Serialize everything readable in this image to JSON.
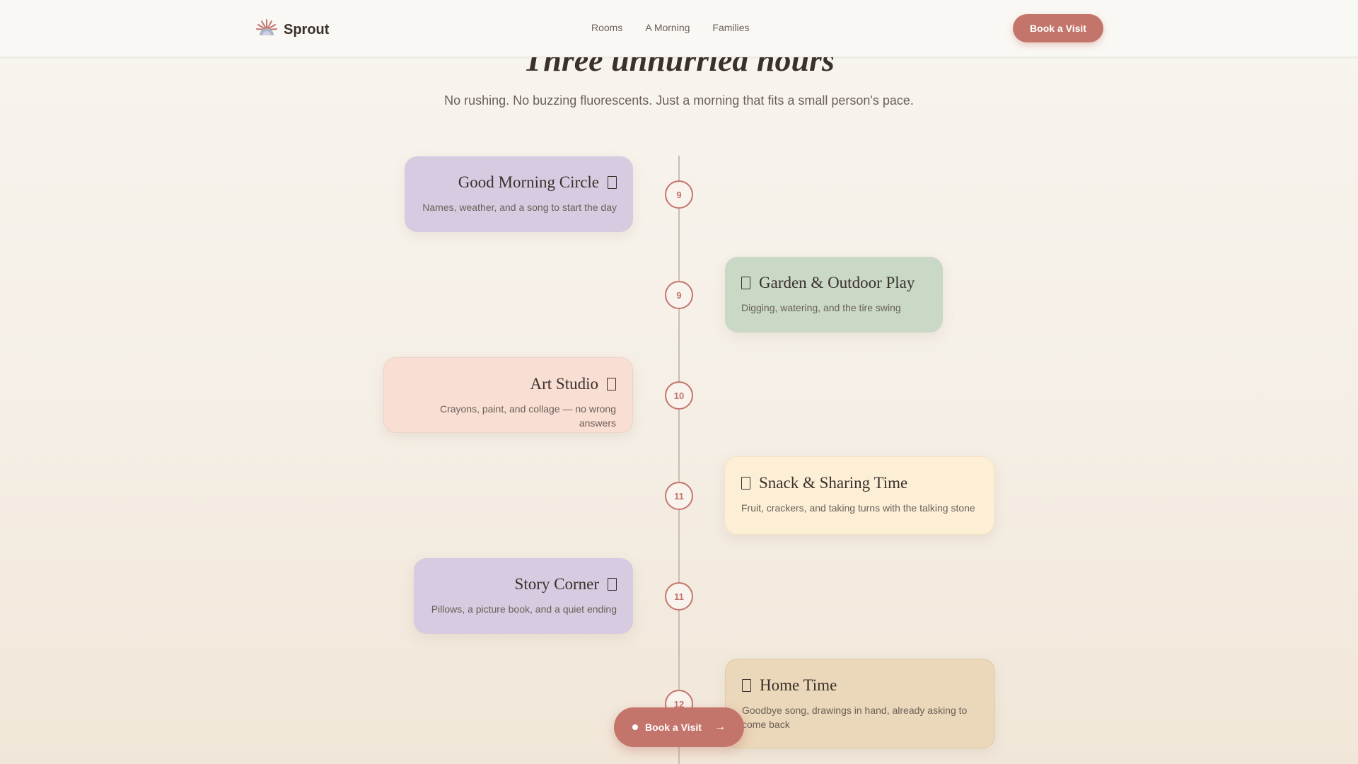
{
  "header": {
    "brand": "Sprout",
    "nav": [
      "Rooms",
      "A Morning",
      "Families"
    ],
    "cta": "Book a Visit"
  },
  "section": {
    "title": "Three unhurried hours",
    "subtitle": "No rushing. No buzzing fluorescents. Just a morning that fits a small person's pace."
  },
  "timeline": [
    {
      "hour": "9",
      "title": "Good Morning Circle",
      "desc": "Names, weather, and a song to start the day",
      "side": "left"
    },
    {
      "hour": "9",
      "title": "Garden & Outdoor Play",
      "desc": "Digging, watering, and the tire swing",
      "side": "right"
    },
    {
      "hour": "10",
      "title": "Art Studio",
      "desc": "Crayons, paint, and collage — no wrong answers",
      "side": "left"
    },
    {
      "hour": "11",
      "title": "Snack & Sharing Time",
      "desc": "Fruit, crackers, and taking turns with the talking stone",
      "side": "right"
    },
    {
      "hour": "11",
      "title": "Story Corner",
      "desc": "Pillows, a picture book, and a quiet ending",
      "side": "left"
    },
    {
      "hour": "12",
      "title": "Home Time",
      "desc": "Goodbye song, drawings in hand, already asking to come back",
      "side": "right"
    }
  ],
  "floating_cta": {
    "label": "Book a Visit",
    "arrow": "→"
  },
  "colors": {
    "accent": "#c4756b",
    "lavender": "#d6cbe0",
    "sage": "#c9d9c6",
    "peach": "#f9ded4",
    "cream": "#fdefd6",
    "sand": "#ebd7b9"
  },
  "icons": {
    "logo": "sun-rays-icon",
    "card": "card-glyph-icon"
  }
}
